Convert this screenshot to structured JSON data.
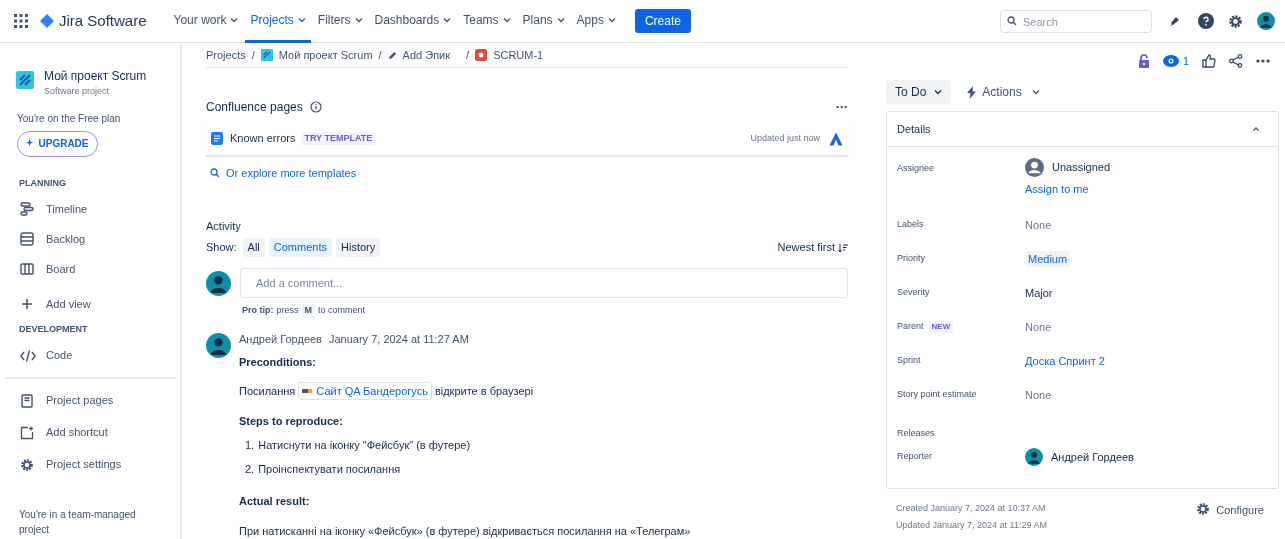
{
  "top_nav": {
    "product": "Jira Software",
    "items": [
      {
        "label": "Your work",
        "selected": false
      },
      {
        "label": "Projects",
        "selected": true
      },
      {
        "label": "Filters",
        "selected": false
      },
      {
        "label": "Dashboards",
        "selected": false
      },
      {
        "label": "Teams",
        "selected": false
      },
      {
        "label": "Plans",
        "selected": false
      },
      {
        "label": "Apps",
        "selected": false
      }
    ],
    "create": "Create",
    "search": {
      "placeholder": "Search"
    }
  },
  "sidebar": {
    "project": "Мой проект Scrum",
    "project_type": "Software project",
    "plan": "You're on the Free plan",
    "upgrade": "UPGRADE",
    "sections": [
      {
        "heading": "PLANNING",
        "items": [
          {
            "label": "Timeline"
          },
          {
            "label": "Backlog"
          },
          {
            "label": "Board"
          },
          {
            "label": "Add view"
          }
        ]
      },
      {
        "heading": "DEVELOPMENT",
        "items": [
          {
            "label": "Code"
          }
        ]
      }
    ],
    "bottom_items": [
      {
        "label": "Project pages"
      },
      {
        "label": "Add shortcut"
      },
      {
        "label": "Project settings"
      }
    ],
    "footer": "You're in a team-managed project"
  },
  "breadcrumbs": [
    {
      "label": "Projects",
      "separator": "/"
    },
    {
      "label": "Мой проект Scrum",
      "separator": "/"
    },
    {
      "label": "Add Эпик",
      "separator": "/"
    },
    {
      "label": "SCRUM-1"
    }
  ],
  "confluence": {
    "title": "Confluence pages",
    "more": "···",
    "page": "Known errors",
    "badge": "TRY TEMPLATE",
    "updated": "Updated just now",
    "explore": "Or explore more templates"
  },
  "activity": {
    "title": "Activity",
    "show": "Show:",
    "filters": [
      {
        "label": "All",
        "selected": false
      },
      {
        "label": "Comments",
        "selected": true
      },
      {
        "label": "History",
        "selected": false
      }
    ],
    "sort": "Newest first",
    "comment_placeholder": "Add a comment...",
    "tip_bold": "Pro tip:",
    "tip_pre": "press",
    "tip_key": "M",
    "tip_post": "to comment",
    "comment": {
      "author": "Андрей Гордеев",
      "time": "January 7, 2024 at 11:27 AM",
      "blocks": [
        {
          "kind": "heading",
          "text": "Preconditions:"
        },
        {
          "kind": "link_line",
          "before": "Посилання",
          "link": "Сайт QA Бандерогусь",
          "after": "відкрите в браузері"
        },
        {
          "kind": "heading",
          "text": "Steps to reproduce:"
        },
        {
          "kind": "list",
          "items": [
            {
              "number": "1.",
              "text": "Натиснути на іконку \"Фейсбук\" (в футере)"
            },
            {
              "number": "2.",
              "text": "Проінспектувати посилання"
            }
          ]
        },
        {
          "kind": "heading",
          "text": "Actual result:"
        },
        {
          "kind": "paragraph",
          "text": "При натисканні на іконку «Фейсбук» (в футере) відкривається посилання на «Телеграм»"
        }
      ]
    }
  },
  "issue_actions": {
    "watchers": "1",
    "status": "To Do",
    "actions": "Actions"
  },
  "details": {
    "title": "Details",
    "expanded": true,
    "fields": [
      {
        "label": "Assignee",
        "kind": "assignee",
        "value": "Unassigned",
        "action": "Assign to me"
      },
      {
        "label": "Labels",
        "kind": "none",
        "value": "None"
      },
      {
        "label": "Priority",
        "kind": "lozenge",
        "value": "Medium"
      },
      {
        "label": "Severity",
        "kind": "text",
        "value": "Major"
      },
      {
        "label": "Parent",
        "badge": "NEW",
        "kind": "none",
        "value": "None"
      },
      {
        "label": "Sprint",
        "kind": "link",
        "value": "Доска Спринт 2"
      },
      {
        "label": "Story point estimate",
        "kind": "none",
        "value": "None"
      },
      {
        "label": "Releases",
        "kind": "empty"
      },
      {
        "label": "Reporter",
        "kind": "user",
        "value": "Андрей Гордеев"
      }
    ]
  },
  "created": "Created January 7, 2024 at 10:37 AM",
  "updated": "Updated January 7, 2024 at 11:29 AM",
  "configure": "Configure"
}
